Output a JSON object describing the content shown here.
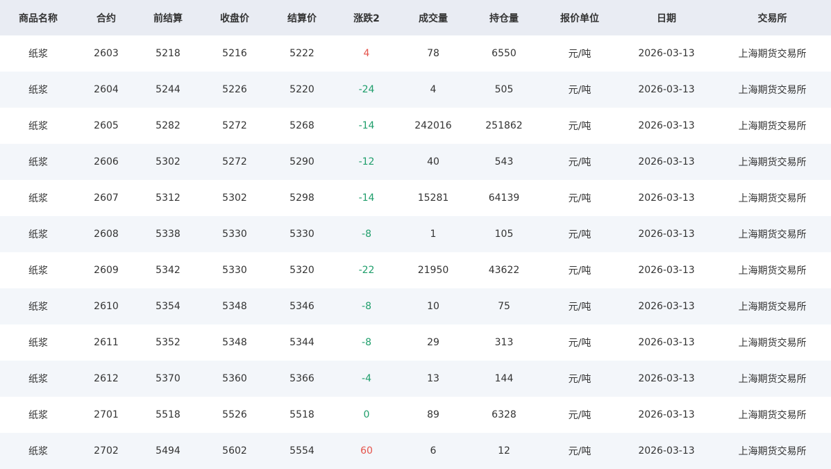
{
  "table": {
    "headers": [
      "商品名称",
      "合约",
      "前结算",
      "收盘价",
      "结算价",
      "涨跌2",
      "成交量",
      "持仓量",
      "报价单位",
      "日期",
      "交易所"
    ],
    "rows": [
      {
        "name": "纸浆",
        "contract": "2603",
        "prev_settle": "5218",
        "close": "5216",
        "settle": "5222",
        "change": "4",
        "direction": "up",
        "volume": "78",
        "open_interest": "6550",
        "unit": "元/吨",
        "date": "2026-03-13",
        "exchange": "上海期货交易所"
      },
      {
        "name": "纸浆",
        "contract": "2604",
        "prev_settle": "5244",
        "close": "5226",
        "settle": "5220",
        "change": "-24",
        "direction": "down",
        "volume": "4",
        "open_interest": "505",
        "unit": "元/吨",
        "date": "2026-03-13",
        "exchange": "上海期货交易所"
      },
      {
        "name": "纸浆",
        "contract": "2605",
        "prev_settle": "5282",
        "close": "5272",
        "settle": "5268",
        "change": "-14",
        "direction": "down",
        "volume": "242016",
        "open_interest": "251862",
        "unit": "元/吨",
        "date": "2026-03-13",
        "exchange": "上海期货交易所"
      },
      {
        "name": "纸浆",
        "contract": "2606",
        "prev_settle": "5302",
        "close": "5272",
        "settle": "5290",
        "change": "-12",
        "direction": "down",
        "volume": "40",
        "open_interest": "543",
        "unit": "元/吨",
        "date": "2026-03-13",
        "exchange": "上海期货交易所"
      },
      {
        "name": "纸浆",
        "contract": "2607",
        "prev_settle": "5312",
        "close": "5302",
        "settle": "5298",
        "change": "-14",
        "direction": "down",
        "volume": "15281",
        "open_interest": "64139",
        "unit": "元/吨",
        "date": "2026-03-13",
        "exchange": "上海期货交易所"
      },
      {
        "name": "纸浆",
        "contract": "2608",
        "prev_settle": "5338",
        "close": "5330",
        "settle": "5330",
        "change": "-8",
        "direction": "down",
        "volume": "1",
        "open_interest": "105",
        "unit": "元/吨",
        "date": "2026-03-13",
        "exchange": "上海期货交易所"
      },
      {
        "name": "纸浆",
        "contract": "2609",
        "prev_settle": "5342",
        "close": "5330",
        "settle": "5320",
        "change": "-22",
        "direction": "down",
        "volume": "21950",
        "open_interest": "43622",
        "unit": "元/吨",
        "date": "2026-03-13",
        "exchange": "上海期货交易所"
      },
      {
        "name": "纸浆",
        "contract": "2610",
        "prev_settle": "5354",
        "close": "5348",
        "settle": "5346",
        "change": "-8",
        "direction": "down",
        "volume": "10",
        "open_interest": "75",
        "unit": "元/吨",
        "date": "2026-03-13",
        "exchange": "上海期货交易所"
      },
      {
        "name": "纸浆",
        "contract": "2611",
        "prev_settle": "5352",
        "close": "5348",
        "settle": "5344",
        "change": "-8",
        "direction": "down",
        "volume": "29",
        "open_interest": "313",
        "unit": "元/吨",
        "date": "2026-03-13",
        "exchange": "上海期货交易所"
      },
      {
        "name": "纸浆",
        "contract": "2612",
        "prev_settle": "5370",
        "close": "5360",
        "settle": "5366",
        "change": "-4",
        "direction": "down",
        "volume": "13",
        "open_interest": "144",
        "unit": "元/吨",
        "date": "2026-03-13",
        "exchange": "上海期货交易所"
      },
      {
        "name": "纸浆",
        "contract": "2701",
        "prev_settle": "5518",
        "close": "5526",
        "settle": "5518",
        "change": "0",
        "direction": "flat",
        "volume": "89",
        "open_interest": "6328",
        "unit": "元/吨",
        "date": "2026-03-13",
        "exchange": "上海期货交易所"
      },
      {
        "name": "纸浆",
        "contract": "2702",
        "prev_settle": "5494",
        "close": "5602",
        "settle": "5554",
        "change": "60",
        "direction": "up",
        "volume": "6",
        "open_interest": "12",
        "unit": "元/吨",
        "date": "2026-03-13",
        "exchange": "上海期货交易所"
      }
    ]
  },
  "colors": {
    "header_bg": "#e9ecf3",
    "row_alt_bg": "#f3f6fa",
    "up": "#e5534b",
    "down": "#1f9e6b"
  }
}
